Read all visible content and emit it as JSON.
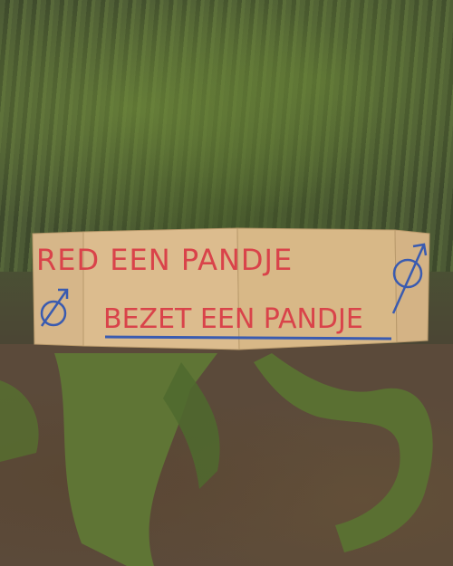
{
  "sign": {
    "line1": "RED EEN PANDJE",
    "line2": "BEZET EEN PANDJE"
  },
  "colors": {
    "cardboard": "#d9b98a",
    "ink_red": "#d9434a",
    "ink_blue": "#3a5bb0",
    "moss": "#6f8a3c",
    "soil": "#5b4a3a"
  },
  "icons": [
    "squatters-symbol-icon",
    "squatters-symbol-icon"
  ]
}
